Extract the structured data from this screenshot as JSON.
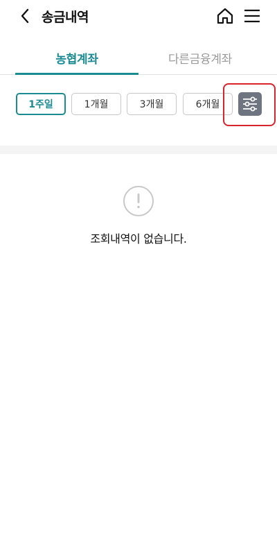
{
  "header": {
    "title": "송금내역",
    "back_icon": "chevron-left-icon",
    "home_icon": "home-icon",
    "menu_icon": "hamburger-menu-icon"
  },
  "tabs": [
    {
      "label": "농협계좌",
      "active": true
    },
    {
      "label": "다른금융계좌",
      "active": false
    }
  ],
  "periods": [
    {
      "label": "1주일",
      "active": true
    },
    {
      "label": "1개월",
      "active": false
    },
    {
      "label": "3개월",
      "active": false
    },
    {
      "label": "6개월",
      "active": false
    }
  ],
  "filter_settings_icon": "sliders-icon",
  "empty_state": {
    "icon": "exclamation-circle-icon",
    "message": "조회내역이 없습니다."
  },
  "colors": {
    "accent": "#1a8a93",
    "highlight": "#d8232a",
    "settings_button": "#6e7480"
  }
}
